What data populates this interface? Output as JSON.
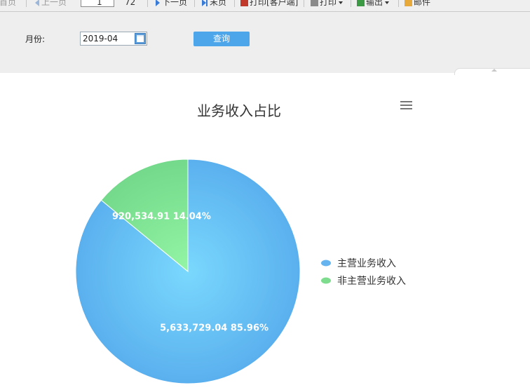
{
  "toolbar": {
    "first": "首页",
    "prev": "上一页",
    "page_current": "1",
    "page_total": "72",
    "next": "下一页",
    "last": "末页",
    "print_client": "打印[客户端]",
    "print": "打印",
    "export": "输出",
    "mail": "邮件"
  },
  "filter": {
    "month_label": "月份:",
    "month_value": "2019-04",
    "query_label": "查询"
  },
  "icons": {
    "calendar": "calendar-icon",
    "menu": "hamburger-menu-icon"
  },
  "chart_data": {
    "type": "pie",
    "title": "业务收入占比",
    "legend_position": "right",
    "slices": [
      {
        "name": "主营业务收入",
        "value": 5633729.04,
        "value_label": "5,633,729.04",
        "percent": "85.96%",
        "color": "#66b4ef"
      },
      {
        "name": "非主营业务收入",
        "value": 920534.91,
        "value_label": "920,534.91",
        "percent": "14.04%",
        "color": "#7ddc8e"
      }
    ]
  }
}
